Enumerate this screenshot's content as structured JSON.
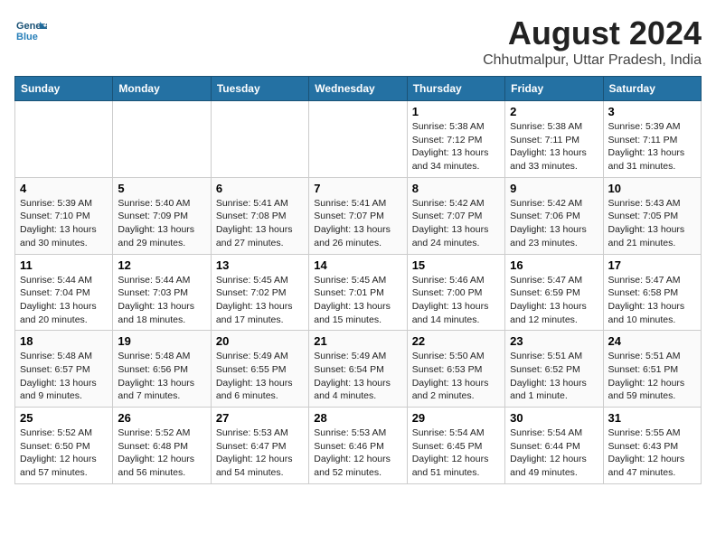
{
  "header": {
    "logo_line1": "General",
    "logo_line2": "Blue",
    "main_title": "August 2024",
    "subtitle": "Chhutmalpur, Uttar Pradesh, India"
  },
  "weekdays": [
    "Sunday",
    "Monday",
    "Tuesday",
    "Wednesday",
    "Thursday",
    "Friday",
    "Saturday"
  ],
  "weeks": [
    [
      {
        "day": "",
        "info": ""
      },
      {
        "day": "",
        "info": ""
      },
      {
        "day": "",
        "info": ""
      },
      {
        "day": "",
        "info": ""
      },
      {
        "day": "1",
        "info": "Sunrise: 5:38 AM\nSunset: 7:12 PM\nDaylight: 13 hours\nand 34 minutes."
      },
      {
        "day": "2",
        "info": "Sunrise: 5:38 AM\nSunset: 7:11 PM\nDaylight: 13 hours\nand 33 minutes."
      },
      {
        "day": "3",
        "info": "Sunrise: 5:39 AM\nSunset: 7:11 PM\nDaylight: 13 hours\nand 31 minutes."
      }
    ],
    [
      {
        "day": "4",
        "info": "Sunrise: 5:39 AM\nSunset: 7:10 PM\nDaylight: 13 hours\nand 30 minutes."
      },
      {
        "day": "5",
        "info": "Sunrise: 5:40 AM\nSunset: 7:09 PM\nDaylight: 13 hours\nand 29 minutes."
      },
      {
        "day": "6",
        "info": "Sunrise: 5:41 AM\nSunset: 7:08 PM\nDaylight: 13 hours\nand 27 minutes."
      },
      {
        "day": "7",
        "info": "Sunrise: 5:41 AM\nSunset: 7:07 PM\nDaylight: 13 hours\nand 26 minutes."
      },
      {
        "day": "8",
        "info": "Sunrise: 5:42 AM\nSunset: 7:07 PM\nDaylight: 13 hours\nand 24 minutes."
      },
      {
        "day": "9",
        "info": "Sunrise: 5:42 AM\nSunset: 7:06 PM\nDaylight: 13 hours\nand 23 minutes."
      },
      {
        "day": "10",
        "info": "Sunrise: 5:43 AM\nSunset: 7:05 PM\nDaylight: 13 hours\nand 21 minutes."
      }
    ],
    [
      {
        "day": "11",
        "info": "Sunrise: 5:44 AM\nSunset: 7:04 PM\nDaylight: 13 hours\nand 20 minutes."
      },
      {
        "day": "12",
        "info": "Sunrise: 5:44 AM\nSunset: 7:03 PM\nDaylight: 13 hours\nand 18 minutes."
      },
      {
        "day": "13",
        "info": "Sunrise: 5:45 AM\nSunset: 7:02 PM\nDaylight: 13 hours\nand 17 minutes."
      },
      {
        "day": "14",
        "info": "Sunrise: 5:45 AM\nSunset: 7:01 PM\nDaylight: 13 hours\nand 15 minutes."
      },
      {
        "day": "15",
        "info": "Sunrise: 5:46 AM\nSunset: 7:00 PM\nDaylight: 13 hours\nand 14 minutes."
      },
      {
        "day": "16",
        "info": "Sunrise: 5:47 AM\nSunset: 6:59 PM\nDaylight: 13 hours\nand 12 minutes."
      },
      {
        "day": "17",
        "info": "Sunrise: 5:47 AM\nSunset: 6:58 PM\nDaylight: 13 hours\nand 10 minutes."
      }
    ],
    [
      {
        "day": "18",
        "info": "Sunrise: 5:48 AM\nSunset: 6:57 PM\nDaylight: 13 hours\nand 9 minutes."
      },
      {
        "day": "19",
        "info": "Sunrise: 5:48 AM\nSunset: 6:56 PM\nDaylight: 13 hours\nand 7 minutes."
      },
      {
        "day": "20",
        "info": "Sunrise: 5:49 AM\nSunset: 6:55 PM\nDaylight: 13 hours\nand 6 minutes."
      },
      {
        "day": "21",
        "info": "Sunrise: 5:49 AM\nSunset: 6:54 PM\nDaylight: 13 hours\nand 4 minutes."
      },
      {
        "day": "22",
        "info": "Sunrise: 5:50 AM\nSunset: 6:53 PM\nDaylight: 13 hours\nand 2 minutes."
      },
      {
        "day": "23",
        "info": "Sunrise: 5:51 AM\nSunset: 6:52 PM\nDaylight: 13 hours\nand 1 minute."
      },
      {
        "day": "24",
        "info": "Sunrise: 5:51 AM\nSunset: 6:51 PM\nDaylight: 12 hours\nand 59 minutes."
      }
    ],
    [
      {
        "day": "25",
        "info": "Sunrise: 5:52 AM\nSunset: 6:50 PM\nDaylight: 12 hours\nand 57 minutes."
      },
      {
        "day": "26",
        "info": "Sunrise: 5:52 AM\nSunset: 6:48 PM\nDaylight: 12 hours\nand 56 minutes."
      },
      {
        "day": "27",
        "info": "Sunrise: 5:53 AM\nSunset: 6:47 PM\nDaylight: 12 hours\nand 54 minutes."
      },
      {
        "day": "28",
        "info": "Sunrise: 5:53 AM\nSunset: 6:46 PM\nDaylight: 12 hours\nand 52 minutes."
      },
      {
        "day": "29",
        "info": "Sunrise: 5:54 AM\nSunset: 6:45 PM\nDaylight: 12 hours\nand 51 minutes."
      },
      {
        "day": "30",
        "info": "Sunrise: 5:54 AM\nSunset: 6:44 PM\nDaylight: 12 hours\nand 49 minutes."
      },
      {
        "day": "31",
        "info": "Sunrise: 5:55 AM\nSunset: 6:43 PM\nDaylight: 12 hours\nand 47 minutes."
      }
    ]
  ]
}
